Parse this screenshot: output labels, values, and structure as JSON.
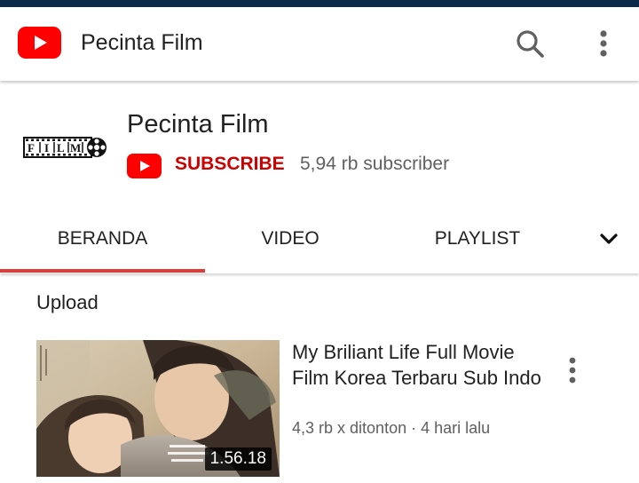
{
  "app_bar": {
    "title": "Pecinta Film",
    "logo_icon": "youtube-logo-icon",
    "search_icon": "search-icon",
    "menu_icon": "more-vertical-icon",
    "brand_color": "#ff0000"
  },
  "channel": {
    "name": "Pecinta Film",
    "avatar_text": "FILM",
    "subscribe_label": "SUBSCRIBE",
    "subscriber_count": "5,94 rb subscriber",
    "subscribe_color": "#cc0000"
  },
  "tabs": [
    {
      "label": "BERANDA",
      "active": true
    },
    {
      "label": "VIDEO",
      "active": false
    },
    {
      "label": "PLAYLIST",
      "active": false
    }
  ],
  "tabs_expand_icon": "chevron-down-icon",
  "active_tab_color": "#e53935",
  "section": {
    "title": "Upload"
  },
  "videos": [
    {
      "title": "My Briliant Life Full Movie Film Korea Terbaru Sub Indo",
      "meta": "4,3 rb x ditonton · 4 hari lalu",
      "duration": "1.56.18",
      "menu_icon": "more-vertical-icon"
    }
  ]
}
